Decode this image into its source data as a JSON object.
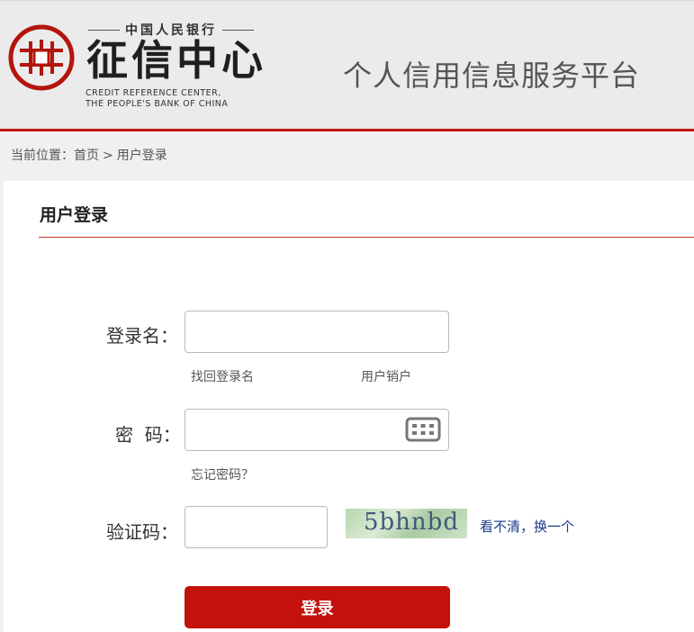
{
  "header": {
    "logo_top_text": "中国人民银行",
    "logo_main_text": "征信中心",
    "logo_en_line1": "CREDIT REFERENCE CENTER,",
    "logo_en_line2": "THE PEOPLE'S BANK OF CHINA",
    "platform_title": "个人信用信息服务平台",
    "accent_color": "#c0150c"
  },
  "breadcrumb": {
    "prefix": "当前位置：",
    "home": "首页",
    "separator": ">",
    "current": "用户登录"
  },
  "login": {
    "title": "用户登录",
    "username_label": "登录名：",
    "username_value": "",
    "find_username_link": "找回登录名",
    "cancel_account_link": "用户销户",
    "password_label": "密  码：",
    "password_value": "",
    "keyboard_icon": "virtual-keyboard-icon",
    "forgot_password_link": "忘记密码？",
    "captcha_label": "验证码：",
    "captcha_value": "",
    "captcha_image_text": "5bhnbd",
    "refresh_captcha_link": "看不清，换一个",
    "submit_label": "登录",
    "button_color": "#c3120c"
  }
}
